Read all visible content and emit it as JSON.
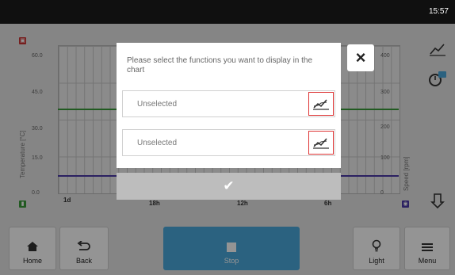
{
  "status": {
    "time": "15:57"
  },
  "chart": {
    "y_left_ticks": [
      "60.0",
      "45.0",
      "30.0",
      "15.0",
      "0.0"
    ],
    "y_right_ticks": [
      "400",
      "300",
      "200",
      "100",
      "0"
    ],
    "x_ticks": [
      "1d",
      "18h",
      "12h",
      "6h"
    ],
    "y_left_label": "Temperature [°C]",
    "y_right_label": "Speed [rpm]"
  },
  "dialog": {
    "title": "Please select the functions you want to display in the chart",
    "select1": "Unselected",
    "select2": "Unselected",
    "close_icon": "×",
    "confirm_icon": "✔"
  },
  "actions": {
    "home": "Home",
    "back": "Back",
    "stop": "Stop",
    "light": "Light",
    "menu": "Menu"
  },
  "colors": {
    "accent": "#4aa9dd",
    "temperature_series": "#3a9b3a",
    "speed_series": "#4a3aa8",
    "highlight": "#dd3333"
  }
}
